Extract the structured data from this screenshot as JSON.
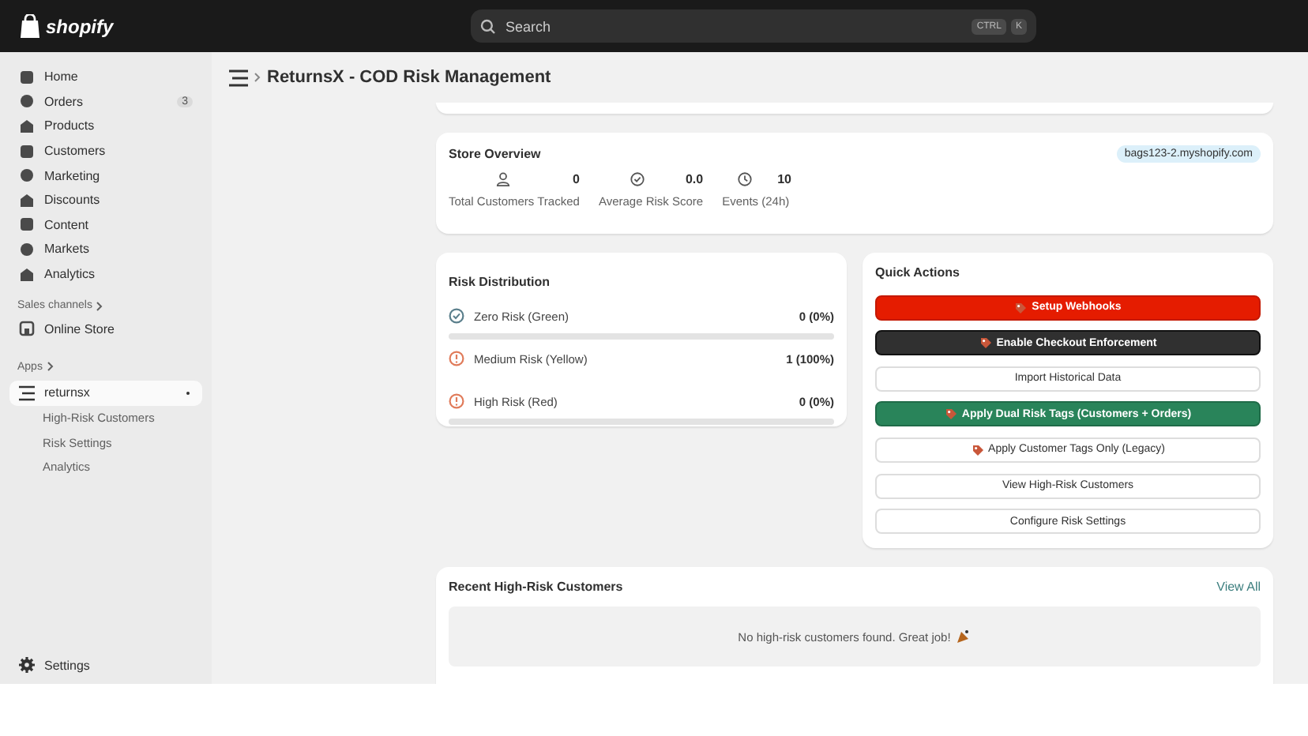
{
  "topbar": {
    "logo": "shopify",
    "search": {
      "placeholder": "Search",
      "keys": [
        "CTRL",
        "K"
      ]
    }
  },
  "sidebar": {
    "items": [
      {
        "label": "Home"
      },
      {
        "label": "Orders",
        "badge": "3"
      },
      {
        "label": "Products"
      },
      {
        "label": "Customers"
      },
      {
        "label": "Marketing"
      },
      {
        "label": "Discounts"
      },
      {
        "label": "Content"
      },
      {
        "label": "Markets"
      },
      {
        "label": "Analytics"
      }
    ],
    "sales_channels": {
      "heading": "Sales channels",
      "items": [
        {
          "label": "Online Store"
        }
      ]
    },
    "apps": {
      "heading": "Apps",
      "app": {
        "label": "returnsx",
        "selected": true,
        "children": [
          {
            "label": "High-Risk Customers"
          },
          {
            "label": "Risk Settings"
          },
          {
            "label": "Analytics"
          }
        ]
      }
    },
    "settings": "Settings"
  },
  "page": {
    "title": "ReturnsX - COD Risk Management"
  },
  "store_overview": {
    "title": "Store Overview",
    "domain": "bags123-2.myshopify.com",
    "stats": [
      {
        "value": "0",
        "label": "Total Customers Tracked"
      },
      {
        "value": "0.0",
        "label": "Average Risk Score"
      },
      {
        "value": "10",
        "label": "Events (24h)"
      }
    ]
  },
  "risk_distribution": {
    "title": "Risk Distribution",
    "rows": [
      {
        "label": "Zero Risk (Green)",
        "count": "0 (0%)",
        "color": "#5b7f8c",
        "level": 0
      },
      {
        "label": "Medium Risk (Yellow)",
        "count": "1 (100%)",
        "color": "#e07b5a"
      },
      {
        "label": "High Risk (Red)",
        "count": "0 (0%)",
        "color": "#e07b5a",
        "level": 0
      }
    ]
  },
  "quick_actions": {
    "title": "Quick Actions",
    "buttons": [
      {
        "label": "Setup Webhooks",
        "kind": "red",
        "icon": true
      },
      {
        "label": "Enable Checkout Enforcement",
        "kind": "dark",
        "icon": true
      },
      {
        "label": "Import Historical Data",
        "kind": "plain",
        "icon": false
      },
      {
        "label": "Apply Dual Risk Tags (Customers + Orders)",
        "kind": "green",
        "icon": true
      },
      {
        "label": "Apply Customer Tags Only (Legacy)",
        "kind": "plain",
        "icon": true
      },
      {
        "label": "View High-Risk Customers",
        "kind": "plain",
        "icon": false
      },
      {
        "label": "Configure Risk Settings",
        "kind": "plain",
        "icon": false
      }
    ]
  },
  "recent": {
    "title": "Recent High-Risk Customers",
    "link": "View All",
    "empty": "No high-risk customers found. Great job!"
  }
}
